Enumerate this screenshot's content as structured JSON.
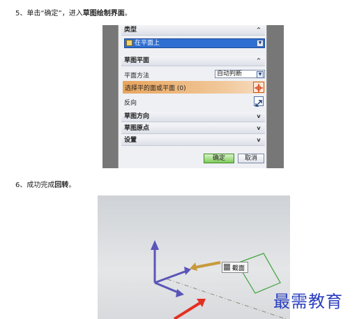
{
  "steps": {
    "step5": {
      "text_a": "5、单击“确定”，进入",
      "text_b": "草图绘制界面",
      "text_c": "。"
    },
    "step6": {
      "text_a": "6、成功完成",
      "text_b": "回转",
      "text_c": "。"
    }
  },
  "dialog": {
    "type_section": {
      "label": "类型",
      "chevron": "^"
    },
    "type_select": {
      "value": "在平面上",
      "icon": "plane-icon"
    },
    "sketch_plane_section": {
      "label": "草图平面",
      "chevron": "^"
    },
    "plane_method": {
      "label": "平面方法",
      "value": "自动判断"
    },
    "select_face": {
      "label": "选择平的面或平面 (0)",
      "icon": "crosshair-icon"
    },
    "reverse": {
      "label": "反向",
      "icon": "reverse-direction-icon"
    },
    "collapsed_sections": [
      {
        "label": "草图方向",
        "chevron": "v"
      },
      {
        "label": "草图原点",
        "chevron": "v"
      },
      {
        "label": "设置",
        "chevron": "v"
      }
    ],
    "ok_label": "确定",
    "cancel_label": "取消"
  },
  "model": {
    "face_label": "截面"
  },
  "watermark": "最需教育",
  "colors": {
    "accent_blue": "#2f6fd1",
    "ok_green": "#7fca5b",
    "highlight_orange": "#e8a45c",
    "pointer_red": "#e43021",
    "watermark_blue": "#2b3fbf"
  }
}
